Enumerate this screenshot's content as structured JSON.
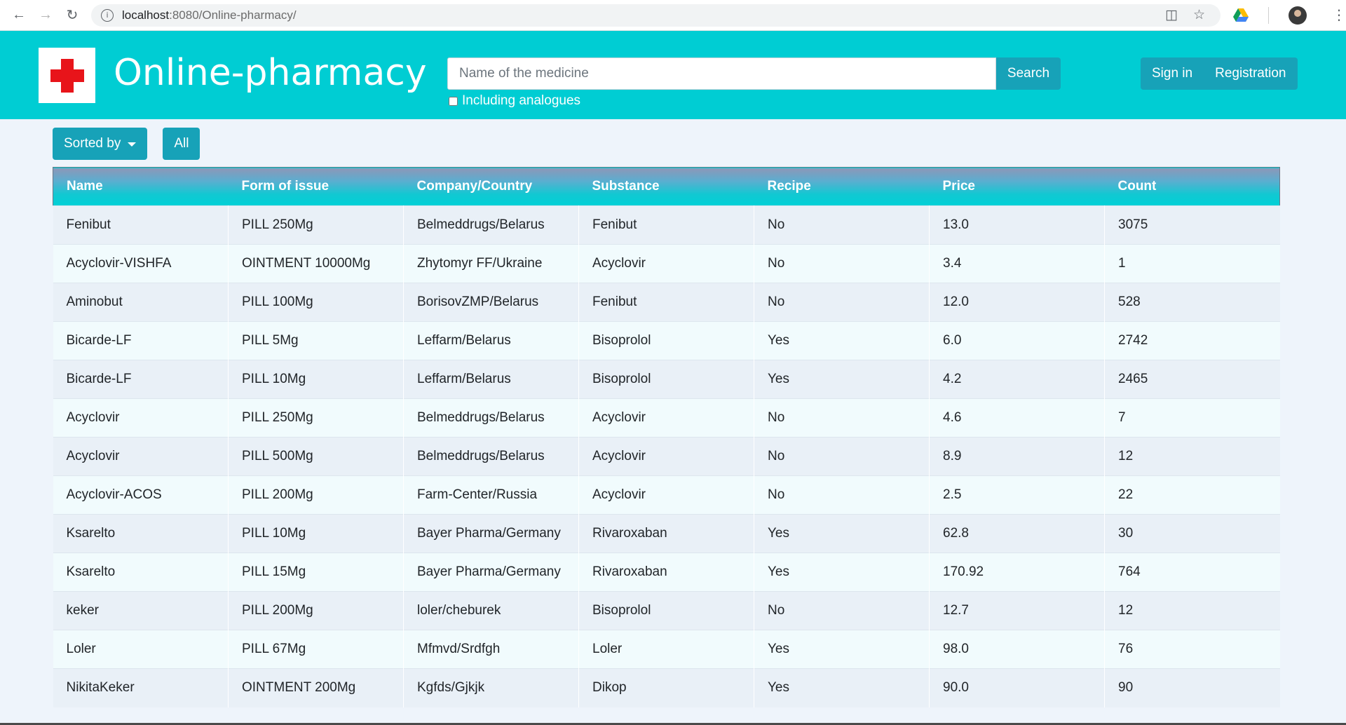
{
  "browser": {
    "url_host": "localhost",
    "url_path": ":8080/Online-pharmacy/"
  },
  "header": {
    "title": "Online-pharmacy",
    "search_placeholder": "Name of the medicine",
    "search_button": "Search",
    "analogues_label": "Including analogues",
    "sign_in": "Sign in",
    "registration": "Registration"
  },
  "toolbar": {
    "sorted_by": "Sorted by",
    "all": "All"
  },
  "colors": {
    "brand": "#00cdd3",
    "button": "#17a2b8",
    "logo_cross": "#e8141a"
  },
  "table": {
    "columns": [
      "Name",
      "Form of issue",
      "Company/Country",
      "Substance",
      "Recipe",
      "Price",
      "Count"
    ],
    "rows": [
      [
        "Fenibut",
        "PILL 250Mg",
        "Belmeddrugs/Belarus",
        "Fenibut",
        "No",
        "13.0",
        "3075"
      ],
      [
        "Acyclovir-VISHFA",
        "OINTMENT 10000Mg",
        "Zhytomyr FF/Ukraine",
        "Acyclovir",
        "No",
        "3.4",
        "1"
      ],
      [
        "Aminobut",
        "PILL 100Mg",
        "BorisovZMP/Belarus",
        "Fenibut",
        "No",
        "12.0",
        "528"
      ],
      [
        "Bicarde-LF",
        "PILL 5Mg",
        "Leffarm/Belarus",
        "Bisoprolol",
        "Yes",
        "6.0",
        "2742"
      ],
      [
        "Bicarde-LF",
        "PILL 10Mg",
        "Leffarm/Belarus",
        "Bisoprolol",
        "Yes",
        "4.2",
        "2465"
      ],
      [
        "Acyclovir",
        "PILL 250Mg",
        "Belmeddrugs/Belarus",
        "Acyclovir",
        "No",
        "4.6",
        "7"
      ],
      [
        "Acyclovir",
        "PILL 500Mg",
        "Belmeddrugs/Belarus",
        "Acyclovir",
        "No",
        "8.9",
        "12"
      ],
      [
        "Acyclovir-ACOS",
        "PILL 200Mg",
        "Farm-Center/Russia",
        "Acyclovir",
        "No",
        "2.5",
        "22"
      ],
      [
        "Ksarelto",
        "PILL 10Mg",
        "Bayer Pharma/Germany",
        "Rivaroxaban",
        "Yes",
        "62.8",
        "30"
      ],
      [
        "Ksarelto",
        "PILL 15Mg",
        "Bayer Pharma/Germany",
        "Rivaroxaban",
        "Yes",
        "170.92",
        "764"
      ],
      [
        "keker",
        "PILL 200Mg",
        "loler/cheburek",
        "Bisoprolol",
        "No",
        "12.7",
        "12"
      ],
      [
        "Loler",
        "PILL 67Mg",
        "Mfmvd/Srdfgh",
        "Loler",
        "Yes",
        "98.0",
        "76"
      ],
      [
        "NikitaKeker",
        "OINTMENT 200Mg",
        "Kgfds/Gjkjk",
        "Dikop",
        "Yes",
        "90.0",
        "90"
      ]
    ]
  }
}
